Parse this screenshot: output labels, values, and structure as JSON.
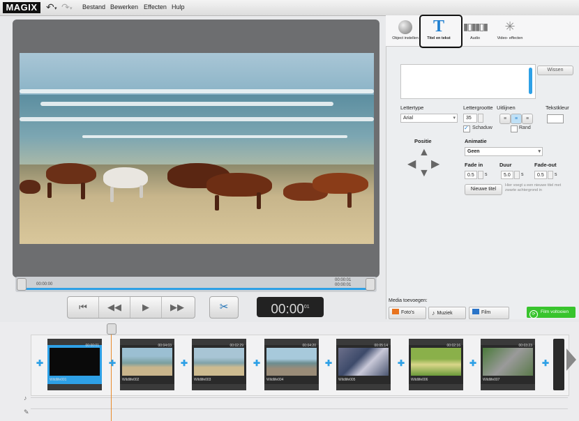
{
  "app": {
    "logo": "MAGIX"
  },
  "menu": {
    "items": [
      "Bestand",
      "Bewerken",
      "Effecten",
      "Hulp"
    ]
  },
  "icons": {
    "undo": "undo-icon",
    "redo": "redo-icon"
  },
  "preview": {
    "timecode_start": "00:00:00",
    "timecode_end_1": "00:00:01",
    "timecode_end_2": "00:00:01"
  },
  "transport": {
    "timecode": "00:00",
    "timecode_frames": "01"
  },
  "tabs": [
    {
      "label": "Object instellen",
      "icon": "sphere-icon"
    },
    {
      "label": "Titel en tekst",
      "icon": "text-t-icon"
    },
    {
      "label": "Audio",
      "icon": "waveform-icon"
    },
    {
      "label": "Video- effecten",
      "icon": "sparkle-icon"
    }
  ],
  "title_panel": {
    "delete_label": "Wissen",
    "font_label": "Lettertype",
    "font_value": "Arial",
    "size_label": "Lettergrootte",
    "size_value": "35",
    "align_label": "Uitlijnen",
    "color_label": "Tekstkleur",
    "shadow_label": "Schaduw",
    "border_label": "Rand",
    "position_label": "Positie",
    "animation_label": "Animatie",
    "animation_value": "Geen",
    "fadein_label": "Fade in",
    "fadein_value": "0.5",
    "duration_label": "Duur",
    "duration_value": "5.0",
    "fadeout_label": "Fade-out",
    "fadeout_value": "0.5",
    "unit_s": "s",
    "new_title_label": "Nieuwe titel",
    "hint_text": "Hier voegt u een nieuwe titel met zwarte achtergrond in"
  },
  "media": {
    "heading": "Media toevoegen:",
    "photos": "Foto's",
    "music": "Muziek",
    "film": "Film",
    "export": "Film voltooien"
  },
  "clips": [
    {
      "name": "Wildlife001",
      "duration": "00:00:01"
    },
    {
      "name": "Wildlife002",
      "duration": "00:04:03"
    },
    {
      "name": "Wildlife003",
      "duration": "00:02:29"
    },
    {
      "name": "Wildlife004",
      "duration": "00:04:20"
    },
    {
      "name": "Wildlife005",
      "duration": "00:05:14"
    },
    {
      "name": "Wildlife006",
      "duration": "00:02:16"
    },
    {
      "name": "Wildlife007",
      "duration": "00:03:23"
    }
  ]
}
